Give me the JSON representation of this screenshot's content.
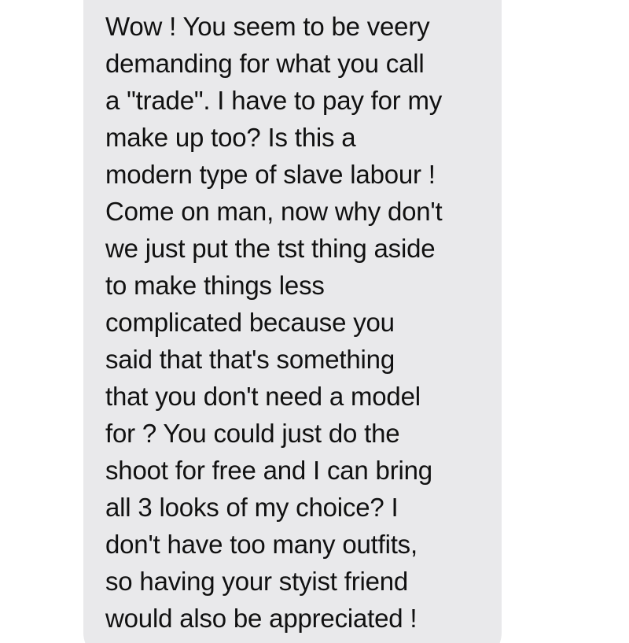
{
  "conversation": {
    "message": {
      "lines": [
        "Wow ! You seem to be veery",
        "demanding for what you call",
        "a \"trade\". I have to pay for my",
        "make up too? Is this a",
        "modern type of slave labour !",
        "Come on man, now why don't",
        "we just put the tst thing aside",
        "to make things less",
        "complicated because you",
        "said that that's something",
        "that you don't need a model",
        "for ? You could just do the",
        "shoot for free and I can bring",
        "all 3 looks of my choice? I",
        "don't have too many outfits,",
        "so having your styist friend",
        "would also be appreciated !"
      ],
      "bubble_color": "#e9e9eb",
      "text_color": "#111111"
    }
  }
}
